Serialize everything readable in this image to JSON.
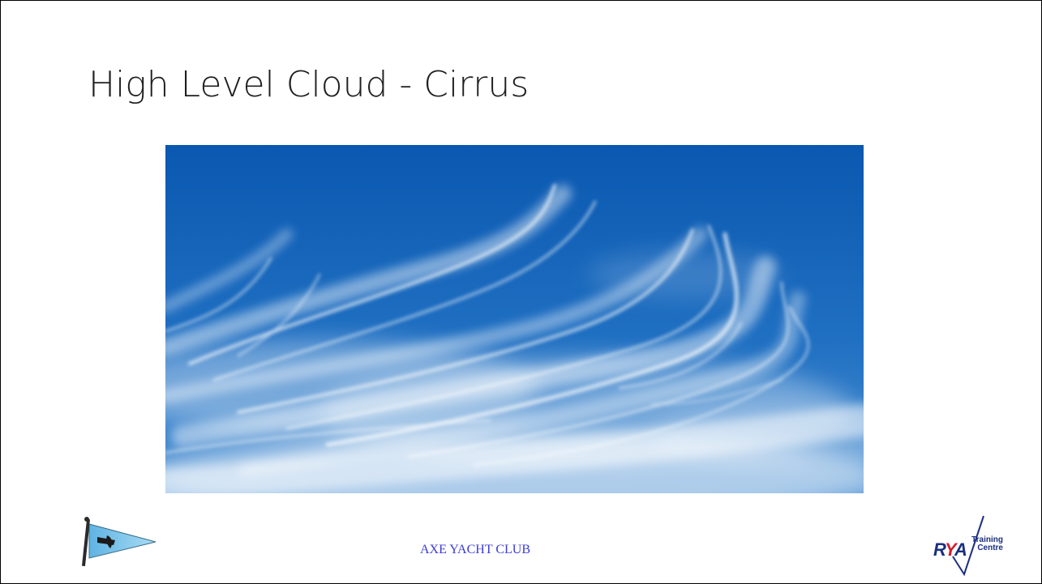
{
  "slide": {
    "title": "High Level Cloud - Cirrus",
    "footer": "AXE YACHT CLUB",
    "photo_subject": "cirrus-clouds",
    "rya_logo": {
      "mark": "RYA",
      "line1": "Training",
      "line2": "Centre"
    }
  },
  "colors": {
    "sky_top": "#0b5cb3",
    "sky_bottom": "#3f87cf",
    "footer_text": "#3b3bd6",
    "flag_blue": "#7cc4ea",
    "rya_navy": "#1a2f80",
    "rya_red": "#d0202e"
  }
}
